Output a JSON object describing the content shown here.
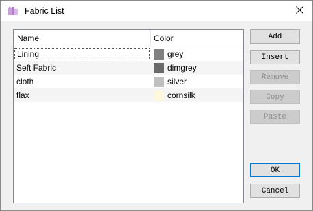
{
  "window": {
    "title": "Fabric List",
    "icon": "app-icon",
    "close_glyph": "✕"
  },
  "list": {
    "columns": [
      "Name",
      "Color"
    ],
    "rows": [
      {
        "name": "Lining",
        "color_name": "grey",
        "swatch": "#808080"
      },
      {
        "name": "Seft Fabric",
        "color_name": "dimgrey",
        "swatch": "#696969"
      },
      {
        "name": "cloth",
        "color_name": "silver",
        "swatch": "#c0c0c0"
      },
      {
        "name": "flax",
        "color_name": "cornsilk",
        "swatch": "#fff8dc"
      }
    ],
    "focused_row": 0
  },
  "buttons": {
    "add": "Add",
    "insert": "Insert",
    "remove": "Remove",
    "copy": "Copy",
    "paste": "Paste",
    "ok": "OK",
    "cancel": "Cancel"
  }
}
